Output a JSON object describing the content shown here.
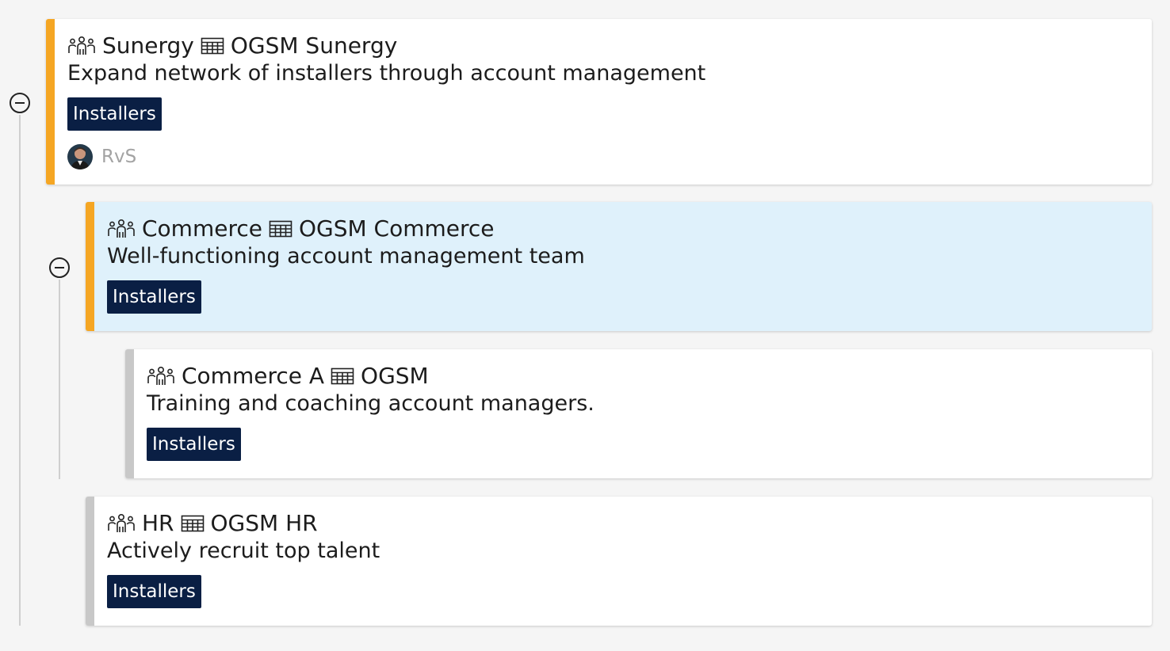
{
  "colors": {
    "accent_orange": "#f5a623",
    "accent_gray": "#c8c8c8",
    "tag_bg": "#0a1f44",
    "highlight_bg": "#dff1fb"
  },
  "icons": {
    "team": "team-icon",
    "sheet": "table-icon"
  },
  "items": [
    {
      "team": "Sunergy",
      "ogsm": "OGSM Sunergy",
      "description": "Expand network of installers through account management",
      "tag": "Installers",
      "owner": "RvS"
    },
    {
      "team": "Commerce",
      "ogsm": "OGSM Commerce",
      "description": "Well-functioning account management team",
      "tag": "Installers"
    },
    {
      "team": "Commerce A",
      "ogsm": "OGSM",
      "description": "Training and coaching account managers.",
      "tag": "Installers"
    },
    {
      "team": "HR",
      "ogsm": "OGSM HR",
      "description": "Actively recruit top talent",
      "tag": "Installers"
    }
  ]
}
